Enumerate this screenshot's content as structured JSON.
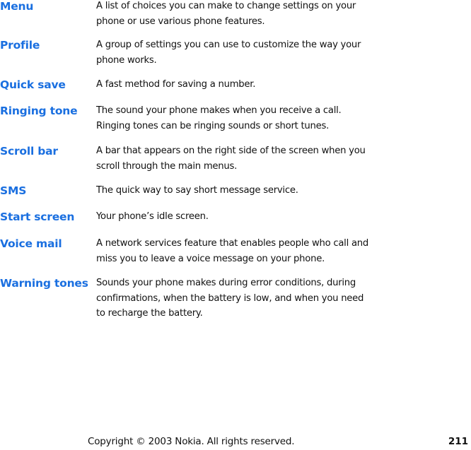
{
  "glossary": [
    {
      "term": "Menu",
      "definition": "A list of choices you can make to change settings on your phone or use various phone features."
    },
    {
      "term": "Profile",
      "definition": "A group of settings you can use to customize the way your phone works."
    },
    {
      "term": "Quick save",
      "definition": "A fast method for saving a number."
    },
    {
      "term": "Ringing tone",
      "definition": "The sound your phone makes when you receive a call. Ringing tones can be ringing sounds or short tunes."
    },
    {
      "term": "Scroll bar",
      "definition": "A bar that appears on the right side of the screen when you scroll through the main menus."
    },
    {
      "term": "SMS",
      "definition": "The quick way to say short message service."
    },
    {
      "term": "Start screen",
      "definition": "Your phone’s idle screen."
    },
    {
      "term": "Voice mail",
      "definition": "A network services feature that enables people who call and miss you to leave a voice message on your phone."
    },
    {
      "term": "Warning tones",
      "definition": "Sounds your phone makes during error conditions, during confirmations, when the battery is low, and when you need to recharge the battery."
    }
  ],
  "footer": {
    "copyright": "Copyright © 2003 Nokia. All rights reserved.",
    "page_number": "211"
  },
  "colors": {
    "term": "#1a6fe0"
  }
}
